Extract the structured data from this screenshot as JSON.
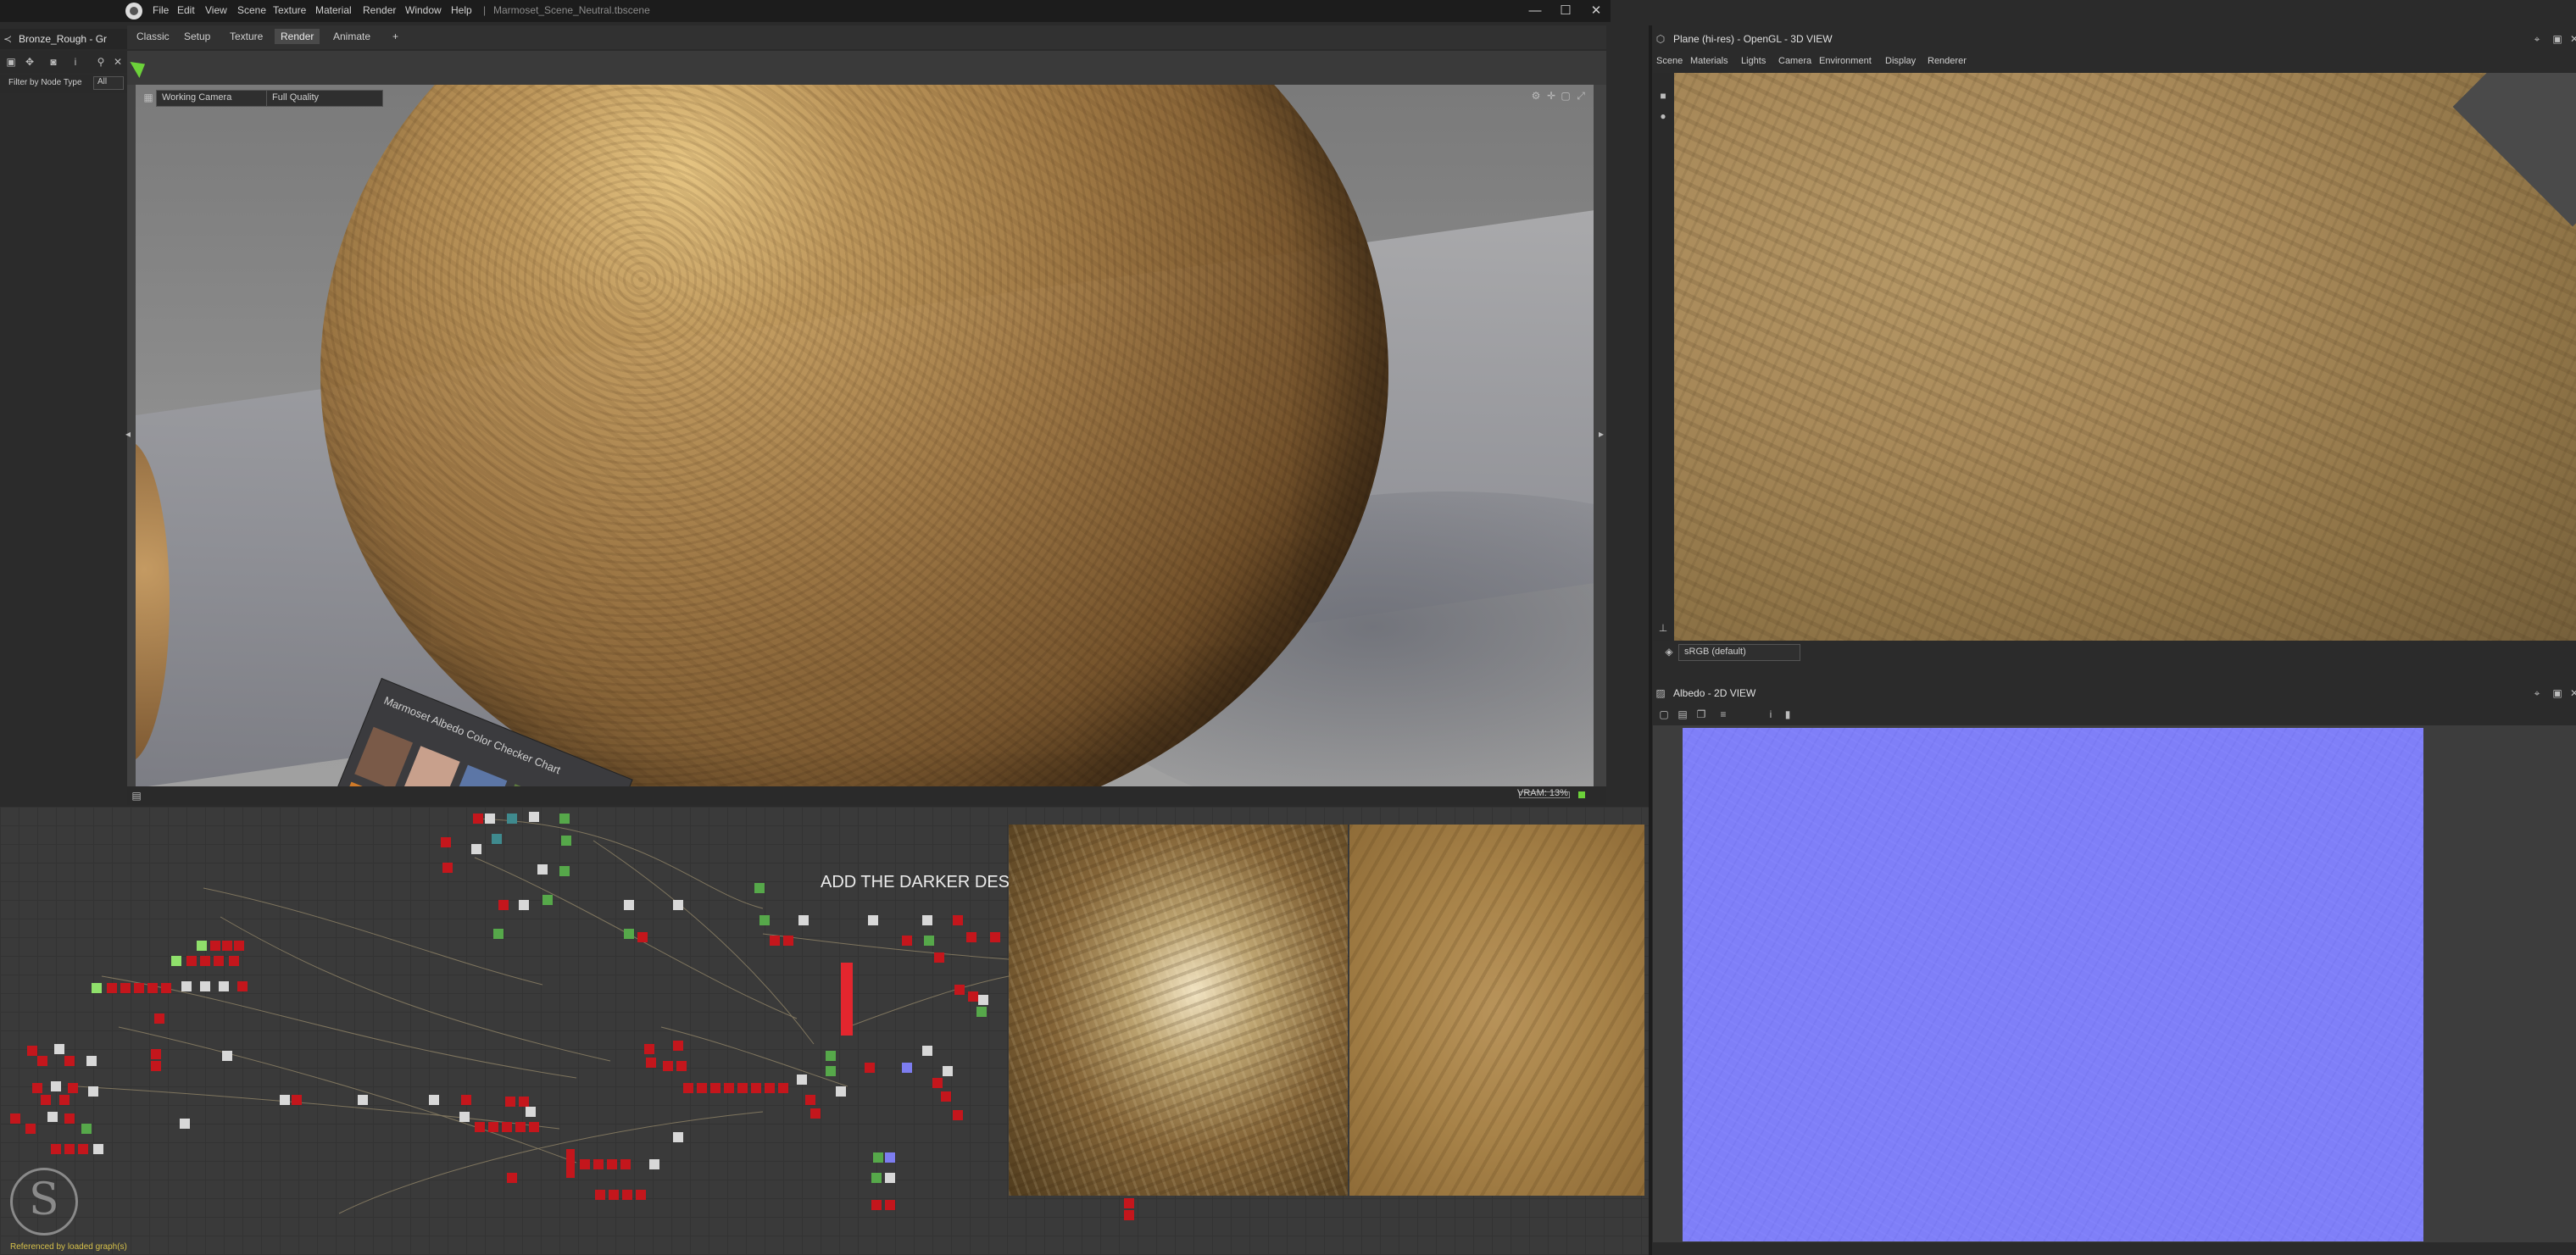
{
  "titlebar": {
    "menus": [
      "File",
      "Edit",
      "View",
      "Scene",
      "Texture",
      "Material",
      "Render",
      "Window",
      "Help"
    ],
    "separator": "|",
    "document": "Marmoset_Scene_Neutral.tbscene",
    "minimize": "—",
    "maximize": "☐",
    "close": "✕"
  },
  "graph_panel": {
    "title": "Bronze_Rough - Gr",
    "filter_label": "Filter by Node Type",
    "filter_value": "All",
    "comment": "ADD THE DARKER DESA",
    "status": "Referenced by loaded graph(s)",
    "logo_letter": "S"
  },
  "marmoset": {
    "tabs": [
      "Classic",
      "Setup",
      "Texture",
      "Render",
      "Animate",
      "+"
    ],
    "active_tab": "Render",
    "camera": "Working Camera",
    "quality": "Full Quality",
    "vram": "VRAM: 13%",
    "checker_title": "Marmoset Albedo Color Checker Chart"
  },
  "view3d": {
    "title": "Plane (hi-res) - OpenGL - 3D VIEW",
    "menu": [
      "Scene",
      "Materials",
      "Lights",
      "Camera",
      "Environment",
      "Display",
      "Renderer"
    ],
    "colorspace": "sRGB (default)"
  },
  "view2d": {
    "title": "Albedo - 2D VIEW"
  },
  "colors": {
    "node_red": "#c4161c",
    "node_white": "#d8d8d8",
    "node_green": "#56a84a",
    "normal_map": "#7f7ff8",
    "bronze": "#a98a5a"
  }
}
